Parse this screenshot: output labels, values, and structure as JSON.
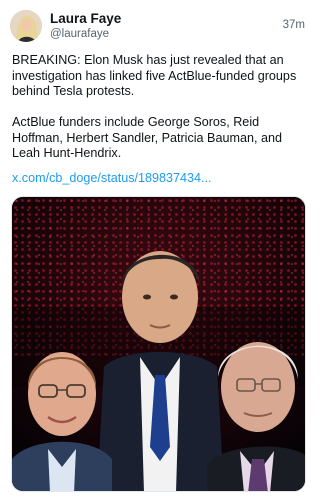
{
  "author": {
    "display_name": "Laura Faye",
    "handle": "@laurafaye",
    "avatar_icon": "user-avatar"
  },
  "timestamp": "37m",
  "post": {
    "paragraph1": "BREAKING: Elon Musk has just revealed that an investigation has linked five ActBlue-funded groups behind Tesla protests.",
    "paragraph2": "ActBlue funders include George Soros, Reid Hoffman, Herbert Sandler, Patricia Bauman, and Leah Hunt-Hendrix.",
    "link_text": "x.com/cb_doge/status/189837434..."
  },
  "media": {
    "kind": "photo-composite",
    "description_icon": "three-men-photo"
  },
  "colors": {
    "text": "#0f1419",
    "muted": "#536471",
    "link": "#1d9bf0",
    "media_bg": "#080306",
    "accent_red": "#c4162a"
  }
}
